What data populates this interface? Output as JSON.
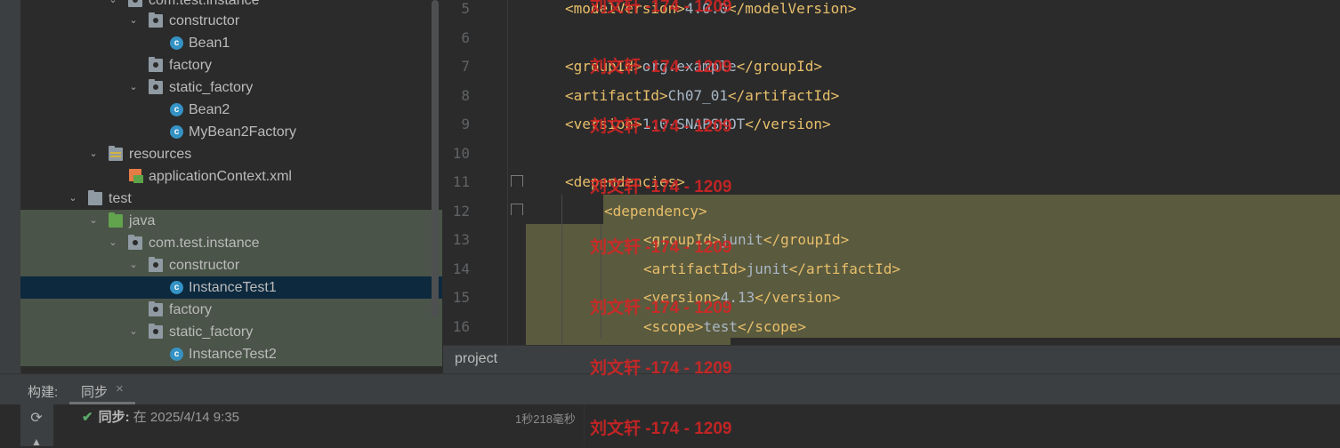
{
  "tree": {
    "items": [
      {
        "label": "com.test.instance",
        "icon": "package-icon",
        "expanded": true
      },
      {
        "label": "constructor",
        "icon": "package-icon",
        "expanded": true
      },
      {
        "label": "Bean1",
        "icon": "class-icon"
      },
      {
        "label": "factory",
        "icon": "package-icon"
      },
      {
        "label": "static_factory",
        "icon": "package-icon",
        "expanded": true
      },
      {
        "label": "Bean2",
        "icon": "class-icon"
      },
      {
        "label": "MyBean2Factory",
        "icon": "class-icon"
      },
      {
        "label": "resources",
        "icon": "resources-folder-icon",
        "expanded": true
      },
      {
        "label": "applicationContext.xml",
        "icon": "xml-file-icon"
      },
      {
        "label": "test",
        "icon": "folder-icon",
        "expanded": true
      },
      {
        "label": "java",
        "icon": "test-source-folder-icon",
        "expanded": true
      },
      {
        "label": "com.test.instance",
        "icon": "package-icon",
        "expanded": true
      },
      {
        "label": "constructor",
        "icon": "package-icon",
        "expanded": true
      },
      {
        "label": "InstanceTest1",
        "icon": "test-class-icon",
        "selected": true
      },
      {
        "label": "factory",
        "icon": "package-icon"
      },
      {
        "label": "static_factory",
        "icon": "package-icon",
        "expanded": true
      },
      {
        "label": "InstanceTest2",
        "icon": "class-icon"
      }
    ]
  },
  "editor": {
    "lines": [
      {
        "no": "5",
        "text": "<modelVersion>4.0.0</modelVersion>"
      },
      {
        "no": "6",
        "text": ""
      },
      {
        "no": "7",
        "text": "<groupId>org.example</groupId>"
      },
      {
        "no": "8",
        "text": "<artifactId>Ch07_01</artifactId>"
      },
      {
        "no": "9",
        "text": "<version>1.0-SNAPSHOT</version>"
      },
      {
        "no": "10",
        "text": ""
      },
      {
        "no": "11",
        "text": "<dependencies>"
      },
      {
        "no": "12",
        "text": "<dependency>"
      },
      {
        "no": "13",
        "text": "<groupId>junit</groupId>"
      },
      {
        "no": "14",
        "text": "<artifactId>junit</artifactId>"
      },
      {
        "no": "15",
        "text": "<version>4.13</version>"
      },
      {
        "no": "16",
        "text": "<scope>test</scope>"
      }
    ],
    "breadcrumb": "project"
  },
  "bottom": {
    "build_label": "构建:",
    "sync_tab": "同步",
    "sync_tab_close": "×",
    "sync_status_bold": "同步:",
    "sync_status_time": " 在 2025/4/14 9:35",
    "sync_duration": "1秒218毫秒"
  },
  "watermark": {
    "text": "刘文轩 -174 - 1209"
  },
  "colors": {
    "background": "#2b2b2b",
    "panel": "#3c3f41",
    "selection": "#0d293e",
    "test_band": "#4a5448",
    "tag": "#e8bf6a",
    "text": "#a9b7c6",
    "line_number": "#606366",
    "highlight": "#5a5a3e",
    "watermark": "#dc2323"
  }
}
